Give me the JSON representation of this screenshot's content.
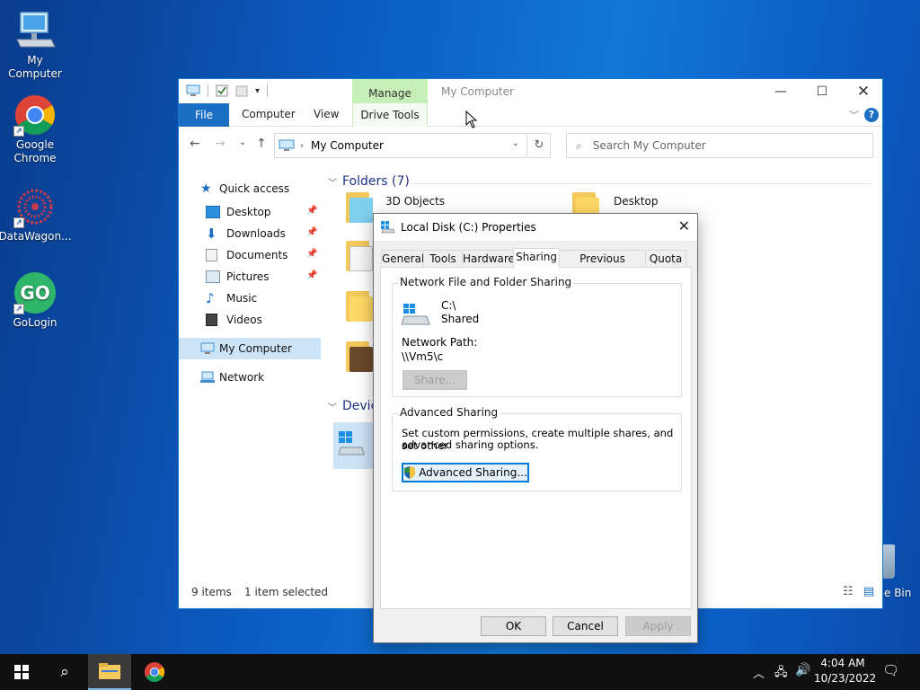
{
  "desktop": {
    "icons": [
      {
        "label": "My Computer"
      },
      {
        "label": "Google Chrome"
      },
      {
        "label": "DataWagon..."
      },
      {
        "label": "GoLogin"
      }
    ],
    "recycle_label": "e Bin"
  },
  "explorer": {
    "manage_tab": "Manage",
    "title": "My Computer",
    "ribbon_tabs": {
      "file": "File",
      "computer": "Computer",
      "view": "View",
      "drive_tools": "Drive Tools"
    },
    "address": "My Computer",
    "search_placeholder": "Search My Computer",
    "nav_pane": {
      "quick_access": "Quick access",
      "items": [
        {
          "label": "Desktop"
        },
        {
          "label": "Downloads"
        },
        {
          "label": "Documents"
        },
        {
          "label": "Pictures"
        },
        {
          "label": "Music"
        },
        {
          "label": "Videos"
        }
      ],
      "my_computer": "My Computer",
      "network": "Network"
    },
    "content": {
      "folders_header": "Folders (7)",
      "folder_1": "3D Objects",
      "folder_2": "Desktop",
      "devices_header": "Devic"
    },
    "status": {
      "items": "9 items",
      "selected": "1 item selected"
    }
  },
  "dialog": {
    "title": "Local Disk (C:) Properties",
    "tabs": [
      "General",
      "Tools",
      "Hardware",
      "Sharing",
      "Previous Versions",
      "Quota"
    ],
    "active_tab": "Sharing",
    "network_sharing": {
      "title": "Network File and Folder Sharing",
      "drive": "C:\\",
      "state": "Shared",
      "path_label": "Network Path:",
      "path_value": "\\\\Vm5\\c",
      "share_button": "Share..."
    },
    "advanced_sharing": {
      "title": "Advanced Sharing",
      "description_1": "Set custom permissions, create multiple shares, and set other",
      "description_2": "advanced sharing options.",
      "button": "Advanced Sharing..."
    },
    "buttons": {
      "ok": "OK",
      "cancel": "Cancel",
      "apply": "Apply"
    }
  },
  "taskbar": {
    "time": "4:04 AM",
    "date": "10/23/2022"
  },
  "colors": {
    "accent": "#0078d7",
    "ribbon_file": "#1a6fc2",
    "manage_tab": "#c6efb7",
    "selection": "#cce4f7"
  }
}
